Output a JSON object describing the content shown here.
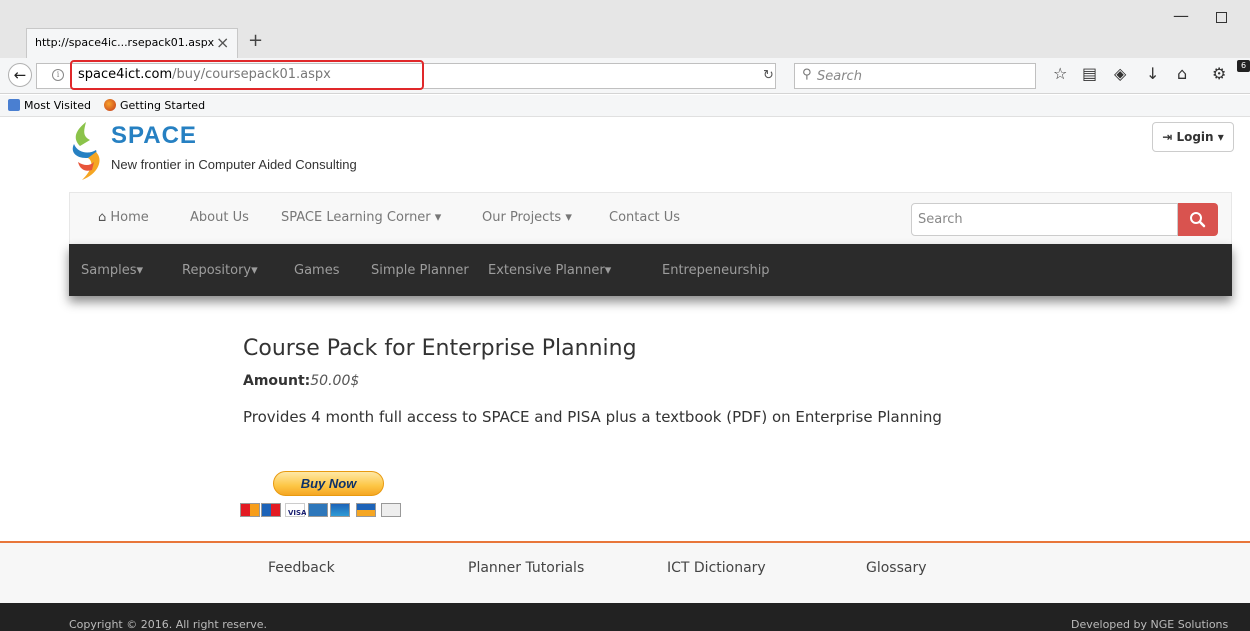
{
  "browser": {
    "tab_title": "http://space4ic...rsepack01.aspx",
    "url_host": "space4ict.com",
    "url_path": "/buy/coursepack01.aspx",
    "search_placeholder": "Search",
    "downloads_badge": "6",
    "bookmarks": [
      {
        "label": "Most Visited",
        "icon": "most-visited-icon"
      },
      {
        "label": "Getting Started",
        "icon": "firefox-icon"
      }
    ]
  },
  "site": {
    "logo_text": "SPACE",
    "tagline": "New frontier in Computer Aided Consulting",
    "login_label": "Login",
    "nav": [
      {
        "label": "Home",
        "icon": "home-icon"
      },
      {
        "label": "About Us"
      },
      {
        "label": "SPACE Learning Corner",
        "dropdown": true
      },
      {
        "label": "Our Projects",
        "dropdown": true
      },
      {
        "label": "Contact Us"
      }
    ],
    "search_placeholder": "Search",
    "subnav": [
      {
        "label": "Samples",
        "dropdown": true
      },
      {
        "label": "Repository",
        "dropdown": true
      },
      {
        "label": "Games"
      },
      {
        "label": "Simple Planner"
      },
      {
        "label": "Extensive Planner",
        "dropdown": true
      },
      {
        "label": "Entrepeneurship"
      }
    ]
  },
  "content": {
    "title": "Course Pack for Enterprise Planning",
    "amount_label": "Amount:",
    "amount_value": "50.00$",
    "description": "Provides 4 month full access to SPACE and PISA plus a textbook (PDF) on Enterprise Planning",
    "buy_now_label": "Buy Now",
    "payment_cards": [
      "mastercard-icon",
      "maestro-icon",
      "visa-icon",
      "amex-icon",
      "discover-icon",
      "paypal-icon",
      "bank-icon"
    ]
  },
  "footer": {
    "links": [
      "Feedback",
      "Planner Tutorials",
      "ICT Dictionary",
      "Glossary"
    ],
    "copyright": "Copyright © 2016. All right reserve.",
    "developer": "Developed by NGE Solutions"
  },
  "colors": {
    "brand_blue": "#2680c2",
    "search_red": "#d9534f",
    "footer_accent": "#e8763a",
    "url_highlight": "#e0282a"
  }
}
